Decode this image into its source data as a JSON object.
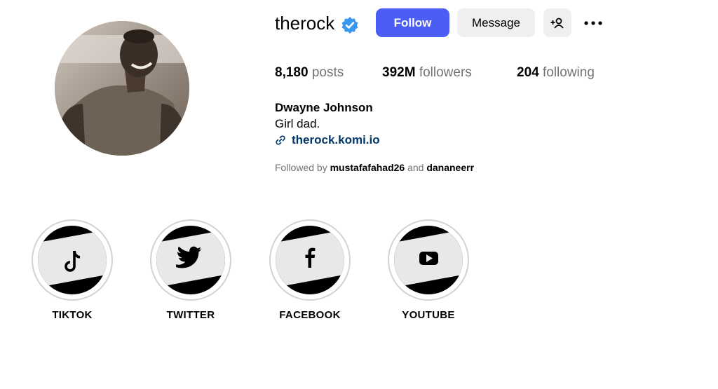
{
  "profile": {
    "username": "therock",
    "verified": true,
    "follow_label": "Follow",
    "message_label": "Message",
    "stats": {
      "posts_count": "8,180",
      "posts_label": "posts",
      "followers_count": "392M",
      "followers_label": "followers",
      "following_count": "204",
      "following_label": "following"
    },
    "full_name": "Dwayne Johnson",
    "bio": "Girl dad.",
    "link": "therock.komi.io",
    "followed_by": {
      "prefix": "Followed by",
      "user1": "mustafafahad26",
      "conjunction": "and",
      "user2": "dananeerr"
    }
  },
  "highlights": [
    {
      "label": "TIKTOK",
      "icon": "tiktok-icon"
    },
    {
      "label": "TWITTER",
      "icon": "twitter-icon"
    },
    {
      "label": "FACEBOOK",
      "icon": "facebook-icon"
    },
    {
      "label": "YOUTUBE",
      "icon": "youtube-icon"
    }
  ],
  "colors": {
    "follow_button": "#4a5df5",
    "secondary_button": "#efefef",
    "verified_badge": "#3897f0",
    "link": "#00376b",
    "muted_text": "#737373"
  }
}
